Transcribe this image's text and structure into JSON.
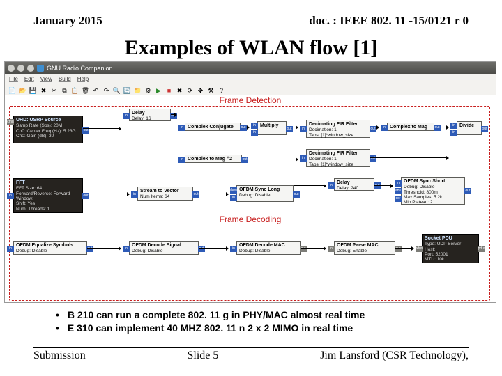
{
  "header": {
    "date": "January 2015",
    "doc": "doc. : IEEE 802. 11 -15/0121 r 0"
  },
  "title": "Examples of WLAN flow [1]",
  "app": {
    "wintitle": "GNU Radio Companion",
    "menus": [
      "File",
      "Edit",
      "View",
      "Build",
      "Help"
    ],
    "section_detect": "Frame Detection",
    "section_decode": "Frame Decoding",
    "toolbar_icons": [
      "new",
      "open",
      "save",
      "close",
      "cut",
      "copy",
      "paste",
      "delete",
      "undo",
      "redo",
      "mag",
      "colors",
      "open2",
      "gen",
      "run",
      "stop",
      "kill",
      "reload",
      "pan",
      "opts",
      "help"
    ]
  },
  "blocks": {
    "usrp": {
      "title": "UHD: USRP Source",
      "l1": "Samp Rate (Sps): 20M",
      "l2": "Ch0: Center Freq (Hz): 5.23G",
      "l3": "Ch0: Gain (dB): 30"
    },
    "delay": {
      "title": "Delay",
      "l1": "Delay: 16"
    },
    "conjug": {
      "title": "Complex Conjugate"
    },
    "mult": {
      "title": "Multiply"
    },
    "mag2": {
      "title": "Complex to Mag ^2"
    },
    "fir1": {
      "title": "Decimating FIR Filter",
      "l1": "Decimation: 1",
      "l2": "Taps: [1]*window_size"
    },
    "fir2": {
      "title": "Decimating FIR Filter",
      "l1": "Decimation: 1",
      "l2": "Taps: [1]*window_size"
    },
    "cmag": {
      "title": "Complex to Mag"
    },
    "div": {
      "title": "Divide"
    },
    "fft": {
      "title": "FFT",
      "l1": "FFT Size: 64",
      "l2": "Forward/Reverse: Forward",
      "l3": "Window: ",
      "l4": "Shift: Yes",
      "l5": "Num. Threads: 1"
    },
    "s2v": {
      "title": "Stream to Vector",
      "l1": "Num Items: 64"
    },
    "slong": {
      "title": "OFDM Sync Long",
      "l1": "Debug: Disable"
    },
    "delay2": {
      "title": "Delay",
      "l1": "Delay: 240"
    },
    "sshort": {
      "title": "OFDM Sync Short",
      "l1": "Debug: Disable",
      "l2": "Threshold: 800m",
      "l3": "Max Samples: 5.2k",
      "l4": "Min Plateau: 2"
    },
    "eqsym": {
      "title": "OFDM Equalize Symbols",
      "l1": "Debug: Disable"
    },
    "dsig": {
      "title": "OFDM Decode Signal",
      "l1": "Debug: Disable"
    },
    "dmac": {
      "title": "OFDM Decode MAC",
      "l1": "Debug: Disable"
    },
    "pmac": {
      "title": "OFDM Parse MAC",
      "l1": "Debug: Enable"
    },
    "sock": {
      "title": "Socket PDU",
      "l1": "Type: UDP Server",
      "l2": "Host: ",
      "l3": "Port: 52001",
      "l4": "MTU: 10k"
    }
  },
  "ports": {
    "in": "in",
    "out": "out",
    "cmd": "cmd",
    "abs": "abs",
    "cor": "cor",
    "pdus": "pdus",
    "delayed": "delayed"
  },
  "bullets": [
    "B 210 can run a complete 802. 11 g in PHY/MAC almost real time",
    "E 310 can implement 40 MHZ 802. 11 n 2 x 2 MIMO in real time"
  ],
  "footer": {
    "left": "Submission",
    "center": "Slide 5",
    "right": "Jim Lansford (CSR Technology),"
  }
}
